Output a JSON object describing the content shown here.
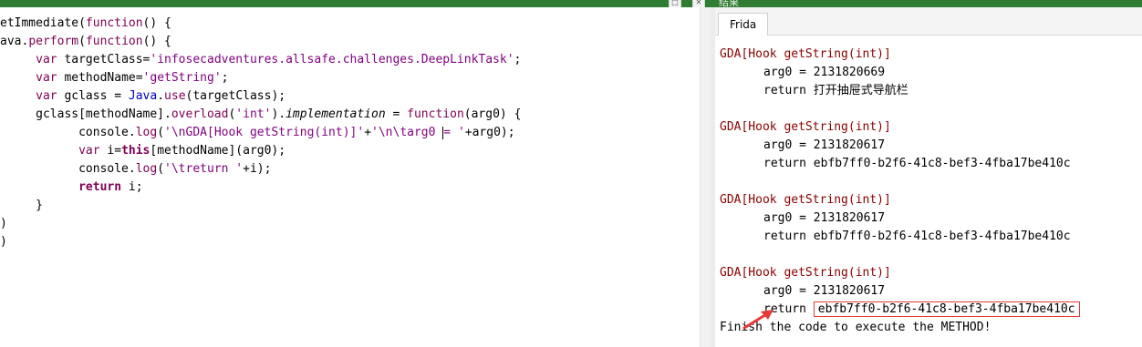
{
  "window": {
    "title": "结果",
    "buttons": [
      "□",
      "✕"
    ]
  },
  "editor": {
    "lines": [
      [
        {
          "t": "etImmediate(",
          "c": ""
        },
        {
          "t": "function",
          "c": "kw2"
        },
        {
          "t": "() {",
          "c": ""
        }
      ],
      [
        {
          "t": "ava.",
          "c": ""
        },
        {
          "t": "perform",
          "c": "fn"
        },
        {
          "t": "(",
          "c": ""
        },
        {
          "t": "function",
          "c": "kw2"
        },
        {
          "t": "() {",
          "c": ""
        }
      ],
      [
        {
          "t": "     ",
          "c": ""
        },
        {
          "t": "var",
          "c": "kw2"
        },
        {
          "t": " targetClass=",
          "c": ""
        },
        {
          "t": "'infosecadventures.allsafe.challenges.DeepLinkTask'",
          "c": "purple"
        },
        {
          "t": ";",
          "c": ""
        }
      ],
      [
        {
          "t": "     ",
          "c": ""
        },
        {
          "t": "var",
          "c": "kw2"
        },
        {
          "t": " methodName=",
          "c": ""
        },
        {
          "t": "'getString'",
          "c": "purple"
        },
        {
          "t": ";",
          "c": ""
        }
      ],
      [
        {
          "t": "     ",
          "c": ""
        },
        {
          "t": "var",
          "c": "kw2"
        },
        {
          "t": " gclass = ",
          "c": ""
        },
        {
          "t": "Java",
          "c": "prop"
        },
        {
          "t": ".",
          "c": ""
        },
        {
          "t": "use",
          "c": "fn"
        },
        {
          "t": "(targetClass);",
          "c": ""
        }
      ],
      [
        {
          "t": "     gclass[methodName].",
          "c": ""
        },
        {
          "t": "overload",
          "c": "fn"
        },
        {
          "t": "(",
          "c": ""
        },
        {
          "t": "'int'",
          "c": "purple"
        },
        {
          "t": ").",
          "c": ""
        },
        {
          "t": "implementation",
          "c": "it"
        },
        {
          "t": " = ",
          "c": ""
        },
        {
          "t": "function",
          "c": "kw2"
        },
        {
          "t": "(arg0) {",
          "c": ""
        }
      ],
      [
        {
          "t": "           console.",
          "c": ""
        },
        {
          "t": "log",
          "c": "fn"
        },
        {
          "t": "(",
          "c": ""
        },
        {
          "t": "'\\nGDA[Hook getString(int)]'",
          "c": "purple"
        },
        {
          "t": "+",
          "c": ""
        },
        {
          "t": "'\\n\\targ0 ",
          "c": "purple"
        },
        {
          "t": "|",
          "c": "cursor"
        },
        {
          "t": "= '",
          "c": "purple"
        },
        {
          "t": "+arg0);",
          "c": ""
        }
      ],
      [
        {
          "t": "           ",
          "c": ""
        },
        {
          "t": "var",
          "c": "kw2"
        },
        {
          "t": " i=",
          "c": ""
        },
        {
          "t": "this",
          "c": "kw"
        },
        {
          "t": "[methodName](arg0);",
          "c": ""
        }
      ],
      [
        {
          "t": "           console.",
          "c": ""
        },
        {
          "t": "log",
          "c": "fn"
        },
        {
          "t": "(",
          "c": ""
        },
        {
          "t": "'\\treturn '",
          "c": "purple"
        },
        {
          "t": "+i);",
          "c": ""
        }
      ],
      [
        {
          "t": "           ",
          "c": ""
        },
        {
          "t": "return",
          "c": "kw"
        },
        {
          "t": " i;",
          "c": ""
        }
      ],
      [
        {
          "t": "     }",
          "c": ""
        }
      ],
      [
        {
          "t": ")",
          "c": ""
        }
      ],
      [
        {
          "t": ")",
          "c": ""
        }
      ]
    ]
  },
  "console": {
    "tab_label": "Frida",
    "hook_header": "GDA[Hook getString(int)]",
    "entries": [
      {
        "arg": "arg0 = 2131820669",
        "ret_label": "return",
        "ret_value": "打开抽屉式导航栏"
      },
      {
        "arg": "arg0 = 2131820617",
        "ret_label": "return",
        "ret_value": "ebfb7ff0-b2f6-41c8-bef3-4fba17be410c"
      },
      {
        "arg": "arg0 = 2131820617",
        "ret_label": "return",
        "ret_value": "ebfb7ff0-b2f6-41c8-bef3-4fba17be410c"
      },
      {
        "arg": "arg0 = 2131820617",
        "ret_label": "return",
        "ret_value": "ebfb7ff0-b2f6-41c8-bef3-4fba17be410c"
      }
    ],
    "finish_text": "Finish the code to execute the METHOD!"
  },
  "colors": {
    "header_red": "#8b0000",
    "highlight_box": "#e53935",
    "arrow": "#e53935",
    "titlebar": "#2e7d32"
  }
}
